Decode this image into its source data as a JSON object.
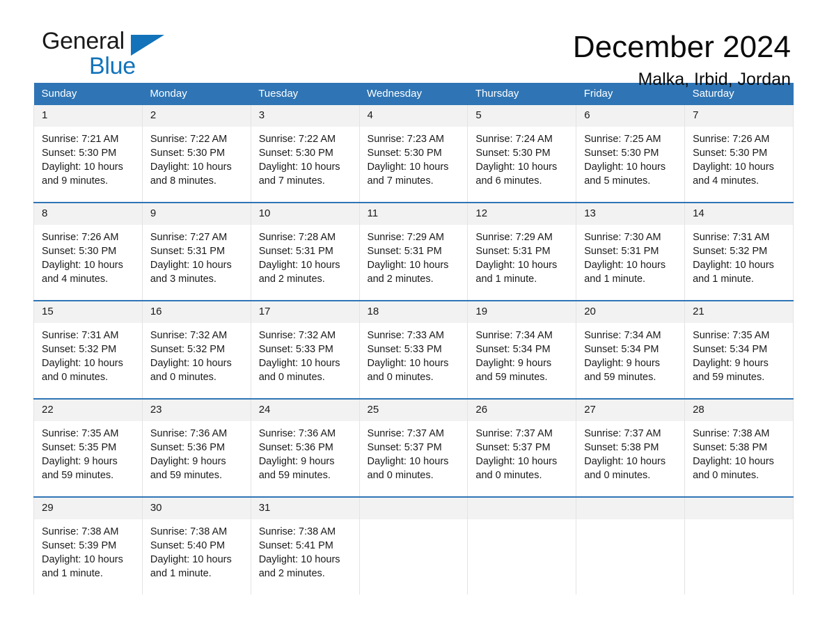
{
  "brand": {
    "name_part1": "General",
    "name_part2": "Blue",
    "triangle_icon": "triangle-icon",
    "accent_color": "#1273ba"
  },
  "header": {
    "month_title": "December 2024",
    "location": "Malka, Irbid, Jordan"
  },
  "calendar": {
    "header_background": "#2f75b5",
    "daynum_background": "#f2f2f2",
    "weekday_headers": [
      "Sunday",
      "Monday",
      "Tuesday",
      "Wednesday",
      "Thursday",
      "Friday",
      "Saturday"
    ],
    "weeks": [
      [
        {
          "day": "1",
          "sunrise": "Sunrise: 7:21 AM",
          "sunset": "Sunset: 5:30 PM",
          "daylight": "Daylight: 10 hours and 9 minutes."
        },
        {
          "day": "2",
          "sunrise": "Sunrise: 7:22 AM",
          "sunset": "Sunset: 5:30 PM",
          "daylight": "Daylight: 10 hours and 8 minutes."
        },
        {
          "day": "3",
          "sunrise": "Sunrise: 7:22 AM",
          "sunset": "Sunset: 5:30 PM",
          "daylight": "Daylight: 10 hours and 7 minutes."
        },
        {
          "day": "4",
          "sunrise": "Sunrise: 7:23 AM",
          "sunset": "Sunset: 5:30 PM",
          "daylight": "Daylight: 10 hours and 7 minutes."
        },
        {
          "day": "5",
          "sunrise": "Sunrise: 7:24 AM",
          "sunset": "Sunset: 5:30 PM",
          "daylight": "Daylight: 10 hours and 6 minutes."
        },
        {
          "day": "6",
          "sunrise": "Sunrise: 7:25 AM",
          "sunset": "Sunset: 5:30 PM",
          "daylight": "Daylight: 10 hours and 5 minutes."
        },
        {
          "day": "7",
          "sunrise": "Sunrise: 7:26 AM",
          "sunset": "Sunset: 5:30 PM",
          "daylight": "Daylight: 10 hours and 4 minutes."
        }
      ],
      [
        {
          "day": "8",
          "sunrise": "Sunrise: 7:26 AM",
          "sunset": "Sunset: 5:30 PM",
          "daylight": "Daylight: 10 hours and 4 minutes."
        },
        {
          "day": "9",
          "sunrise": "Sunrise: 7:27 AM",
          "sunset": "Sunset: 5:31 PM",
          "daylight": "Daylight: 10 hours and 3 minutes."
        },
        {
          "day": "10",
          "sunrise": "Sunrise: 7:28 AM",
          "sunset": "Sunset: 5:31 PM",
          "daylight": "Daylight: 10 hours and 2 minutes."
        },
        {
          "day": "11",
          "sunrise": "Sunrise: 7:29 AM",
          "sunset": "Sunset: 5:31 PM",
          "daylight": "Daylight: 10 hours and 2 minutes."
        },
        {
          "day": "12",
          "sunrise": "Sunrise: 7:29 AM",
          "sunset": "Sunset: 5:31 PM",
          "daylight": "Daylight: 10 hours and 1 minute."
        },
        {
          "day": "13",
          "sunrise": "Sunrise: 7:30 AM",
          "sunset": "Sunset: 5:31 PM",
          "daylight": "Daylight: 10 hours and 1 minute."
        },
        {
          "day": "14",
          "sunrise": "Sunrise: 7:31 AM",
          "sunset": "Sunset: 5:32 PM",
          "daylight": "Daylight: 10 hours and 1 minute."
        }
      ],
      [
        {
          "day": "15",
          "sunrise": "Sunrise: 7:31 AM",
          "sunset": "Sunset: 5:32 PM",
          "daylight": "Daylight: 10 hours and 0 minutes."
        },
        {
          "day": "16",
          "sunrise": "Sunrise: 7:32 AM",
          "sunset": "Sunset: 5:32 PM",
          "daylight": "Daylight: 10 hours and 0 minutes."
        },
        {
          "day": "17",
          "sunrise": "Sunrise: 7:32 AM",
          "sunset": "Sunset: 5:33 PM",
          "daylight": "Daylight: 10 hours and 0 minutes."
        },
        {
          "day": "18",
          "sunrise": "Sunrise: 7:33 AM",
          "sunset": "Sunset: 5:33 PM",
          "daylight": "Daylight: 10 hours and 0 minutes."
        },
        {
          "day": "19",
          "sunrise": "Sunrise: 7:34 AM",
          "sunset": "Sunset: 5:34 PM",
          "daylight": "Daylight: 9 hours and 59 minutes."
        },
        {
          "day": "20",
          "sunrise": "Sunrise: 7:34 AM",
          "sunset": "Sunset: 5:34 PM",
          "daylight": "Daylight: 9 hours and 59 minutes."
        },
        {
          "day": "21",
          "sunrise": "Sunrise: 7:35 AM",
          "sunset": "Sunset: 5:34 PM",
          "daylight": "Daylight: 9 hours and 59 minutes."
        }
      ],
      [
        {
          "day": "22",
          "sunrise": "Sunrise: 7:35 AM",
          "sunset": "Sunset: 5:35 PM",
          "daylight": "Daylight: 9 hours and 59 minutes."
        },
        {
          "day": "23",
          "sunrise": "Sunrise: 7:36 AM",
          "sunset": "Sunset: 5:36 PM",
          "daylight": "Daylight: 9 hours and 59 minutes."
        },
        {
          "day": "24",
          "sunrise": "Sunrise: 7:36 AM",
          "sunset": "Sunset: 5:36 PM",
          "daylight": "Daylight: 9 hours and 59 minutes."
        },
        {
          "day": "25",
          "sunrise": "Sunrise: 7:37 AM",
          "sunset": "Sunset: 5:37 PM",
          "daylight": "Daylight: 10 hours and 0 minutes."
        },
        {
          "day": "26",
          "sunrise": "Sunrise: 7:37 AM",
          "sunset": "Sunset: 5:37 PM",
          "daylight": "Daylight: 10 hours and 0 minutes."
        },
        {
          "day": "27",
          "sunrise": "Sunrise: 7:37 AM",
          "sunset": "Sunset: 5:38 PM",
          "daylight": "Daylight: 10 hours and 0 minutes."
        },
        {
          "day": "28",
          "sunrise": "Sunrise: 7:38 AM",
          "sunset": "Sunset: 5:38 PM",
          "daylight": "Daylight: 10 hours and 0 minutes."
        }
      ],
      [
        {
          "day": "29",
          "sunrise": "Sunrise: 7:38 AM",
          "sunset": "Sunset: 5:39 PM",
          "daylight": "Daylight: 10 hours and 1 minute."
        },
        {
          "day": "30",
          "sunrise": "Sunrise: 7:38 AM",
          "sunset": "Sunset: 5:40 PM",
          "daylight": "Daylight: 10 hours and 1 minute."
        },
        {
          "day": "31",
          "sunrise": "Sunrise: 7:38 AM",
          "sunset": "Sunset: 5:41 PM",
          "daylight": "Daylight: 10 hours and 2 minutes."
        },
        {
          "day": "",
          "sunrise": "",
          "sunset": "",
          "daylight": ""
        },
        {
          "day": "",
          "sunrise": "",
          "sunset": "",
          "daylight": ""
        },
        {
          "day": "",
          "sunrise": "",
          "sunset": "",
          "daylight": ""
        },
        {
          "day": "",
          "sunrise": "",
          "sunset": "",
          "daylight": ""
        }
      ]
    ]
  }
}
